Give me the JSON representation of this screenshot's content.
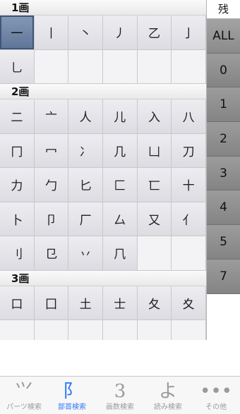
{
  "sections": [
    {
      "header": "1画",
      "cells": [
        "一",
        "丨",
        "丶",
        "丿",
        "乙",
        "亅",
        "乚",
        "",
        "",
        "",
        "",
        ""
      ],
      "selected_index": 0
    },
    {
      "header": "2画",
      "cells": [
        "二",
        "亠",
        "人",
        "儿",
        "入",
        "八",
        "冂",
        "冖",
        "冫",
        "几",
        "凵",
        "刀",
        "力",
        "勹",
        "匕",
        "匚",
        "匸",
        "十",
        "卜",
        "卩",
        "厂",
        "厶",
        "又",
        "亻",
        "刂",
        "㔾",
        "丷",
        "𠘨",
        "",
        ""
      ]
    },
    {
      "header": "3画",
      "cells": [
        "口",
        "囗",
        "土",
        "士",
        "夂",
        "夊"
      ]
    }
  ],
  "stroke_panel": {
    "header": "残",
    "buttons": [
      "ALL",
      "0",
      "1",
      "2",
      "3",
      "4",
      "5",
      "7"
    ],
    "active": "ALL"
  },
  "tab_bar": {
    "tabs": [
      {
        "label": "パーツ検索",
        "icon": "parts-icon",
        "glyph": "⺍"
      },
      {
        "label": "部首検索",
        "icon": "radical-icon",
        "glyph": "阝"
      },
      {
        "label": "画数検索",
        "icon": "stroke-count-icon",
        "glyph": "3"
      },
      {
        "label": "読み検索",
        "icon": "reading-icon",
        "glyph": "よ"
      },
      {
        "label": "その他",
        "icon": "more-icon",
        "glyph": "•••"
      }
    ],
    "active_index": 1,
    "active_color": "#2f7bf5",
    "inactive_color": "#9a9a9a"
  }
}
